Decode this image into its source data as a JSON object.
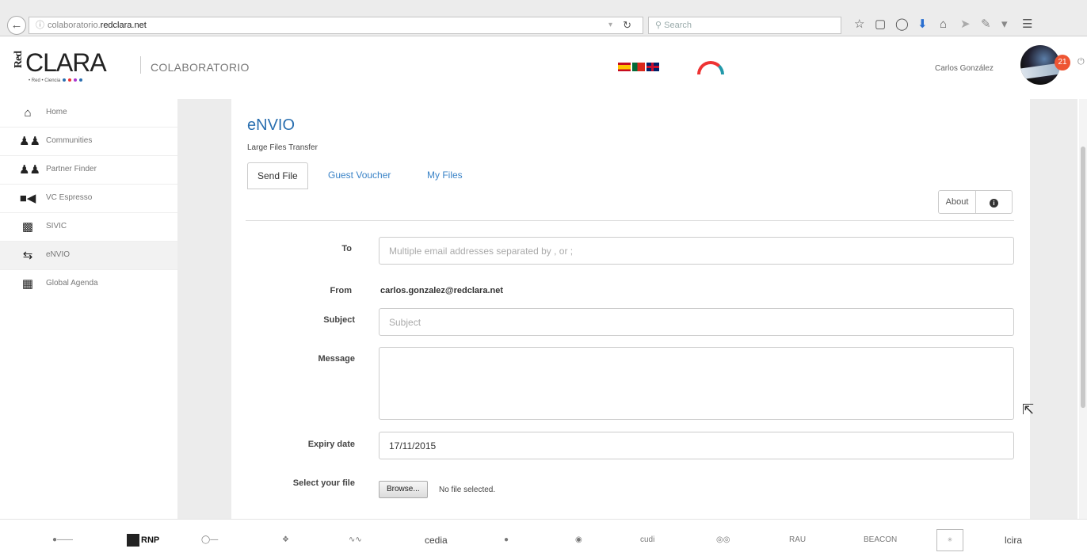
{
  "browser": {
    "url_prefix": "colaboratorio.",
    "url_host": "redclara.net",
    "search_placeholder": "Search"
  },
  "header": {
    "logo_red": "Red",
    "logo_clara": "CLARA",
    "logo_sub": "• Red • Ciencia",
    "section_title": "COLABORATORIO",
    "user_name": "Carlos González",
    "notifications": "21"
  },
  "sidebar": {
    "items": [
      {
        "label": "Home",
        "icon": "home-icon"
      },
      {
        "label": "Communities",
        "icon": "users-icon"
      },
      {
        "label": "Partner Finder",
        "icon": "user-pair-icon"
      },
      {
        "label": "VC Espresso",
        "icon": "video-camera-icon"
      },
      {
        "label": "SIVIC",
        "icon": "sivic-icon"
      },
      {
        "label": "eNVIO",
        "icon": "transfer-arrows-icon"
      },
      {
        "label": "Global Agenda",
        "icon": "calendar-icon"
      }
    ],
    "active_index": 5
  },
  "main": {
    "title": "eNVIO",
    "subtitle": "Large Files Transfer",
    "tabs": [
      "Send File",
      "Guest Voucher",
      "My Files"
    ],
    "active_tab": 0,
    "about_label": "About"
  },
  "form": {
    "to_label": "To",
    "to_placeholder": "Multiple email addresses separated by , or ;",
    "from_label": "From",
    "from_value": "carlos.gonzalez@redclara.net",
    "subject_label": "Subject",
    "subject_placeholder": "Subject",
    "message_label": "Message",
    "expiry_label": "Expiry date",
    "expiry_value": "17/11/2015",
    "file_label": "Select your file",
    "browse_label": "Browse...",
    "file_status": "No file selected."
  },
  "footer": {
    "partners": [
      "RNP",
      "cedia",
      "cudi",
      "RAU",
      "BEACON",
      "lcira"
    ]
  },
  "colors": {
    "accent": "#2a6fb0",
    "link": "#3a83c7",
    "notification": "#ee5533"
  }
}
